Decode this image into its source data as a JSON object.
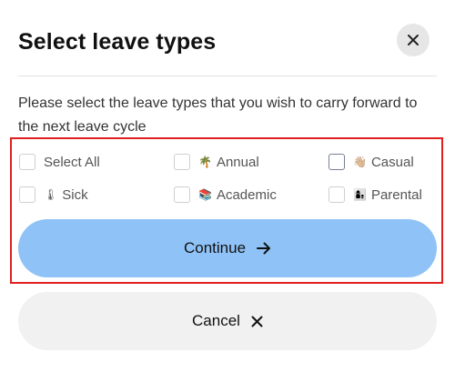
{
  "dialog": {
    "title": "Select leave types",
    "description": "Please select the leave types that you wish to carry forward to the next leave cycle"
  },
  "options": [
    {
      "label": "Select All",
      "emoji": "",
      "checked": false
    },
    {
      "label": "Annual",
      "emoji": "🌴",
      "checked": false
    },
    {
      "label": "Casual",
      "emoji": "👋🏼",
      "checked": false
    },
    {
      "label": "Sick",
      "emoji": "🌡",
      "checked": false
    },
    {
      "label": "Academic",
      "emoji": "📚",
      "checked": false
    },
    {
      "label": "Parental",
      "emoji": "👩‍👦",
      "checked": false
    }
  ],
  "buttons": {
    "continue_label": "Continue",
    "cancel_label": "Cancel"
  },
  "icons": {
    "close": "close-icon",
    "continue": "arrow-right-icon",
    "cancel": "close-icon"
  },
  "colors": {
    "continue_bg": "#8fc3f7",
    "cancel_bg": "#f1f1f1",
    "highlight_border": "#e01f1f"
  }
}
